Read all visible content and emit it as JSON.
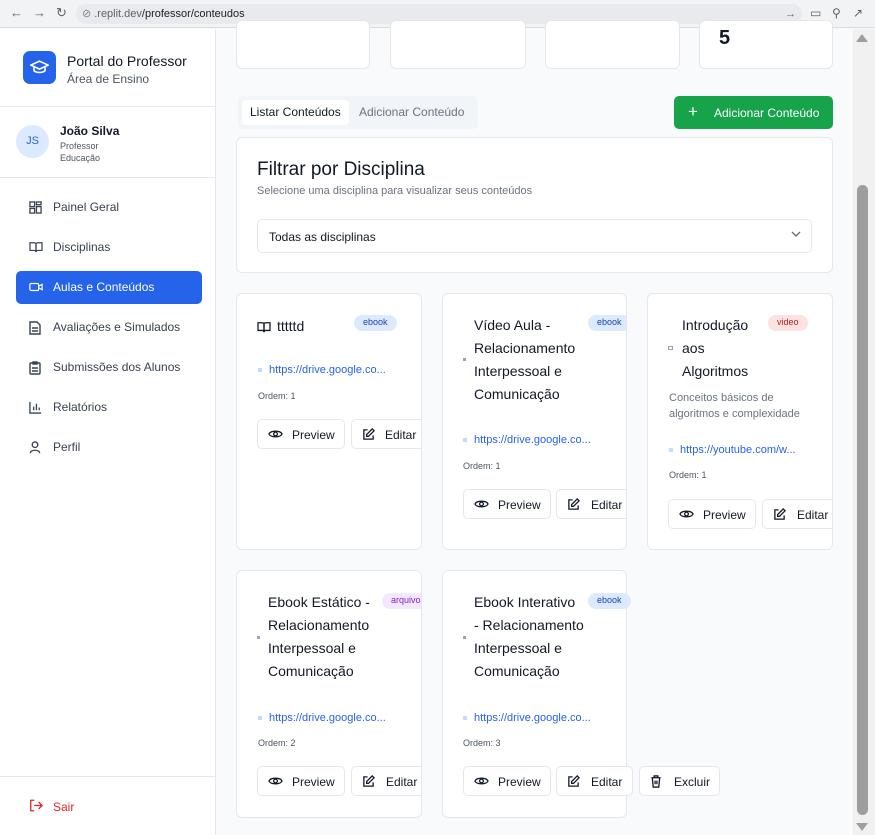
{
  "browser": {
    "url_prefix": ".replit.dev",
    "url_path": "/professor/conteudos"
  },
  "sidebar": {
    "brand_title": "Portal do Professor",
    "brand_sub": "Área de Ensino",
    "user_initials": "JS",
    "user_name": "João Silva",
    "user_role": "Professor",
    "user_area": "Educação",
    "items": [
      {
        "label": "Painel Geral",
        "icon": "grid-icon"
      },
      {
        "label": "Disciplinas",
        "icon": "book-open-icon"
      },
      {
        "label": "Aulas e Conteúdos",
        "icon": "video-icon",
        "active": true
      },
      {
        "label": "Avaliações e Simulados",
        "icon": "file-text-icon"
      },
      {
        "label": "Submissões dos Alunos",
        "icon": "clipboard-icon"
      },
      {
        "label": "Relatórios",
        "icon": "bar-chart-icon"
      },
      {
        "label": "Perfil",
        "icon": "user-icon"
      }
    ],
    "logout_label": "Sair"
  },
  "stats": {
    "last_value": "5"
  },
  "tabs": [
    {
      "label": "Listar Conteúdos",
      "active": true
    },
    {
      "label": "Adicionar Conteúdo",
      "active": false
    }
  ],
  "add_button_label": "Adicionar Conteúdo",
  "filter": {
    "title": "Filtrar por Disciplina",
    "subtitle": "Selecione uma disciplina para visualizar seus conteúdos",
    "selected": "Todas as disciplinas"
  },
  "actions": {
    "preview": "Preview",
    "edit": "Editar",
    "delete": "Excluir"
  },
  "contents": [
    {
      "title": "tttttd",
      "badge": "ebook",
      "link": "https://drive.google.co...",
      "order": "Ordem: 1"
    },
    {
      "title_lines": [
        "Vídeo Aula -",
        "Relacionamento",
        "Interpessoal e",
        "Comunicação"
      ],
      "badge": "ebook",
      "link": "https://drive.google.co...",
      "order": "Ordem: 1"
    },
    {
      "title_lines": [
        "Introdução",
        "aos",
        "Algoritmos"
      ],
      "badge": "video",
      "description_lines": [
        "Conceitos básicos de",
        "algoritmos e complexidade"
      ],
      "link": "https://youtube.com/w...",
      "order": "Ordem: 1"
    },
    {
      "title_lines": [
        "Ebook Estático -",
        "Relacionamento",
        "Interpessoal e",
        "Comunicação"
      ],
      "badge": "arquivo",
      "link": "https://drive.google.co...",
      "order": "Ordem: 2"
    },
    {
      "title_lines": [
        "Ebook Interativo",
        "- Relacionamento",
        "Interpessoal e",
        "Comunicação"
      ],
      "badge": "ebook",
      "link": "https://drive.google.co...",
      "order": "Ordem: 3"
    }
  ],
  "colors": {
    "primary": "#2563eb",
    "success": "#16a34a",
    "danger": "#dc2626"
  }
}
